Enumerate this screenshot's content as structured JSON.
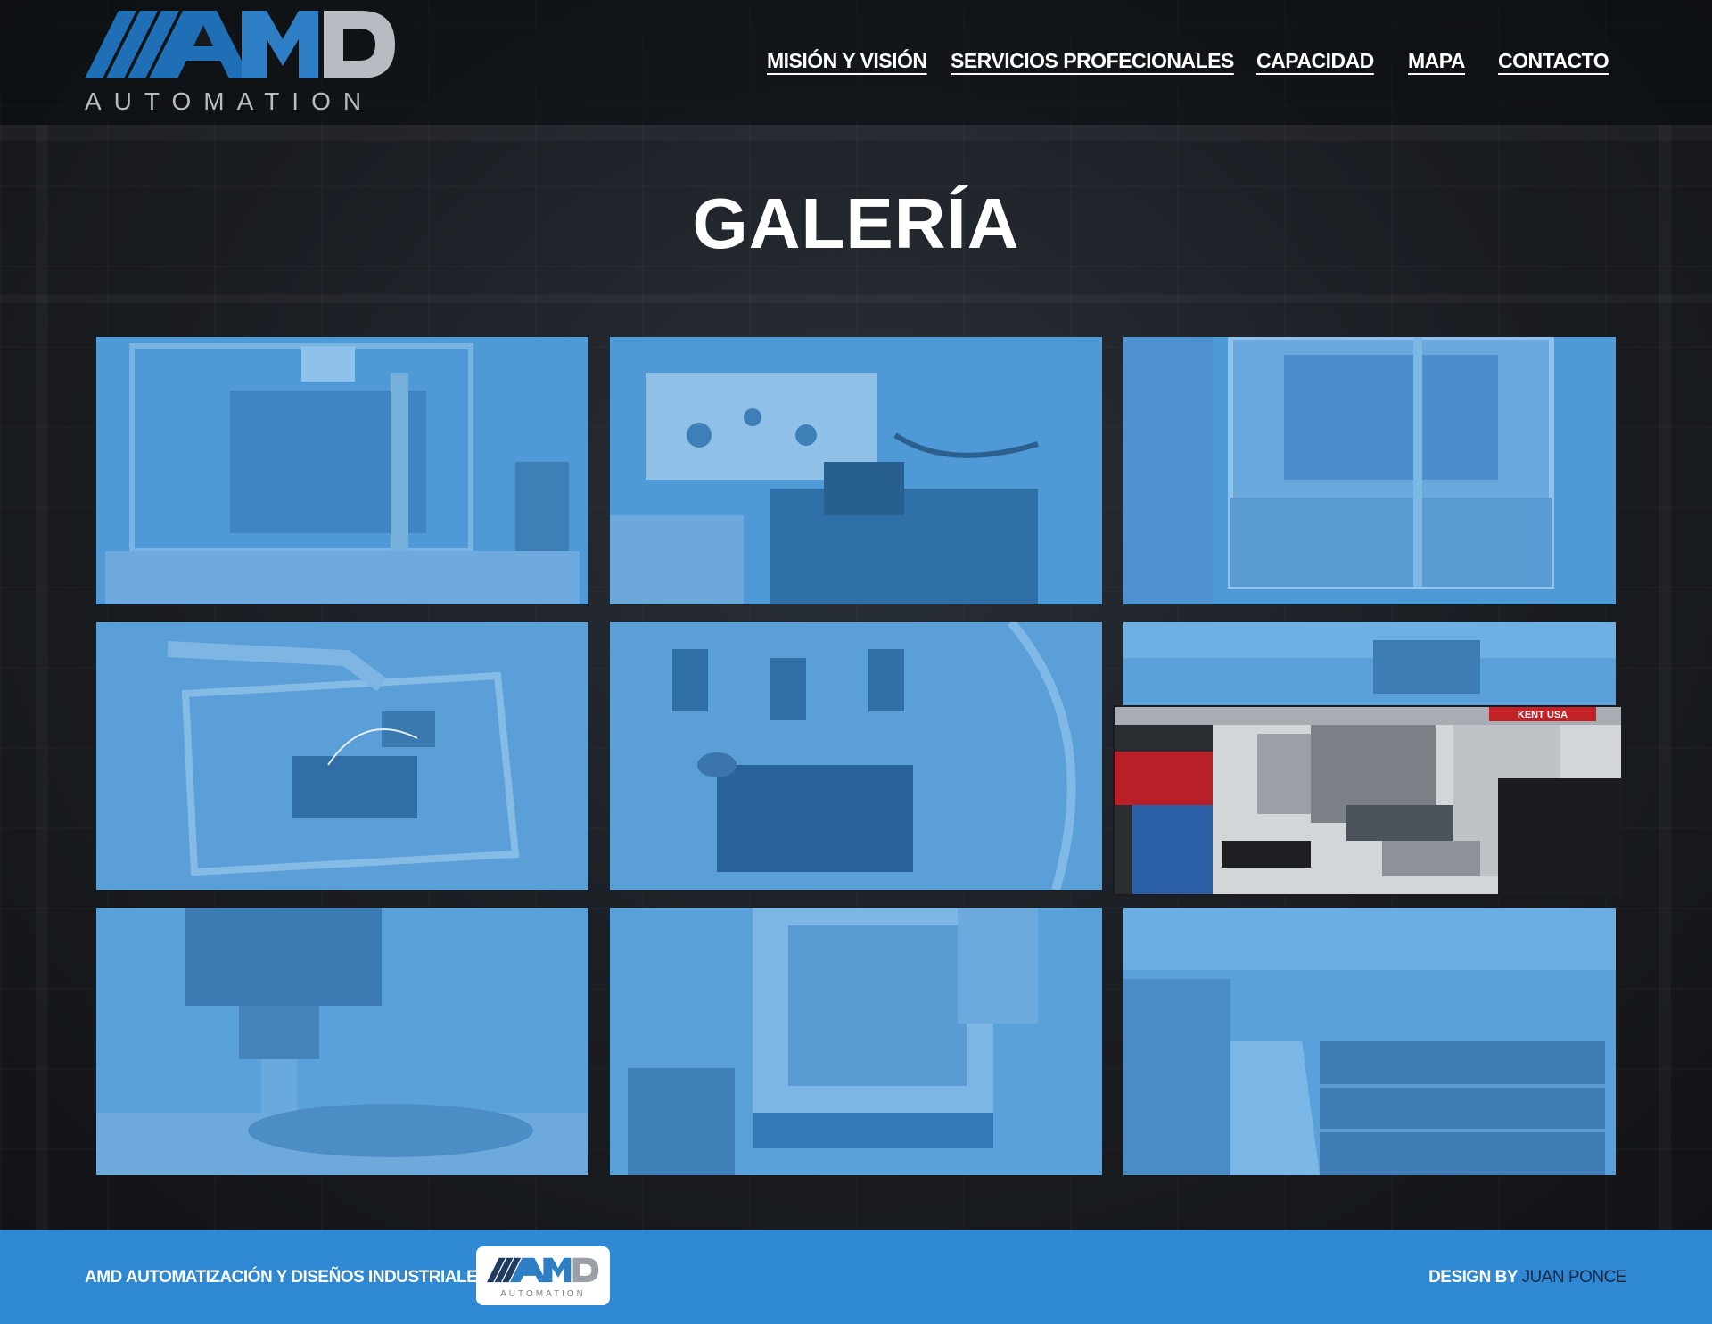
{
  "brand": {
    "logo_text": "AMD",
    "logo_subtext": "AUTOMATION",
    "colors": {
      "accent_blue": "#2e88d4",
      "logo_blue": "#1f6fb6",
      "logo_gray": "#b8bcc2"
    }
  },
  "nav": {
    "items": [
      {
        "label": "MISIÓN Y VISIÓN"
      },
      {
        "label": "SERVICIOS PROFECIONALES"
      },
      {
        "label": "CAPACIDAD"
      },
      {
        "label": "MAPA"
      },
      {
        "label": "CONTACTO"
      }
    ]
  },
  "page": {
    "title": "GALERÍA"
  },
  "gallery": {
    "overlay_color": "#4f9ad6",
    "tiles": [
      {
        "subject": "automation-cell"
      },
      {
        "subject": "fixture-block"
      },
      {
        "subject": "enclosed-machine"
      },
      {
        "subject": "wiring-panel"
      },
      {
        "subject": "clamp-station"
      },
      {
        "subject": "milling-machines"
      },
      {
        "subject": "cnc-spindle"
      },
      {
        "subject": "cnc-mill"
      },
      {
        "subject": "warehouse-aisle"
      }
    ],
    "hovered_tile_sign": "KENT USA"
  },
  "footer": {
    "company": "AMD AUTOMATIZACIÓN Y DISEÑOS INDUSTRIALES",
    "logo_text": "AMD",
    "logo_subtext": "AUTOMATION",
    "credit_prefix": "DESIGN BY",
    "credit_name": "JUAN PONCE"
  }
}
